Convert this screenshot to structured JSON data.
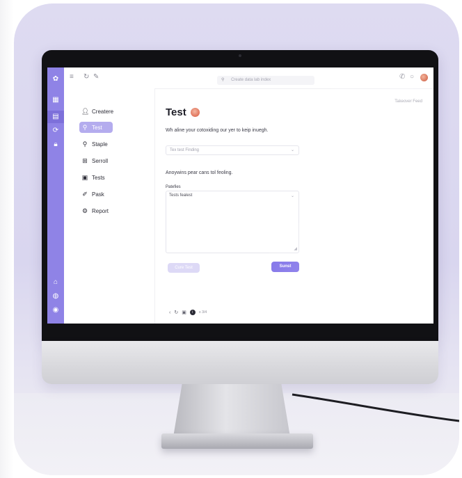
{
  "colors": {
    "accent": "#8f83e6",
    "accent_dark": "#7d6ee8",
    "accent_light": "#b4acee",
    "backdrop": "#dedbf1"
  },
  "topbar": {
    "menu_icon": "hamburger-icon",
    "search_placeholder": "Create data lab index",
    "icons": [
      "refresh-icon",
      "edit-icon",
      "phone-icon",
      "bell-icon"
    ]
  },
  "rail": {
    "icons": [
      "logo-icon",
      "grid-icon",
      "document-icon",
      "refresh-icon",
      "lock-icon",
      "home-icon",
      "globe-icon",
      "help-icon"
    ]
  },
  "sidebar": {
    "items": [
      {
        "label": "Createre",
        "icon": "user-icon"
      },
      {
        "label": "Test",
        "icon": "search-icon",
        "active": true
      },
      {
        "label": "Staple",
        "icon": "search-icon"
      },
      {
        "label": "Serroll",
        "icon": "gallery-icon"
      },
      {
        "label": "Tests",
        "icon": "calendar-icon"
      },
      {
        "label": "Pask",
        "icon": "pen-icon"
      },
      {
        "label": "Report",
        "icon": "gear-icon"
      }
    ]
  },
  "main": {
    "top_link": "Takeover Feed",
    "title": "Test",
    "subtitle": "Wh aline your cotoxiding our yer to keip inuegh.",
    "select_value": "Tex test Finding",
    "prompt": "Anoywins pear cans tol feoling.",
    "field_label": "Patefies",
    "textarea_value": "Tests fealest",
    "secondary_button": "Cure Test",
    "primary_button": "Sunst",
    "bottom_tool_text": "≡ 3/4"
  }
}
